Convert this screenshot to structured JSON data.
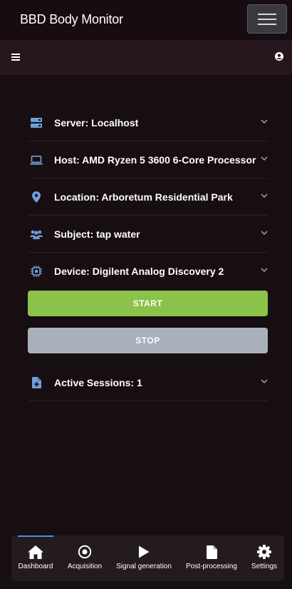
{
  "app": {
    "title": "BBD Body Monitor"
  },
  "colors": {
    "accent_start": "#8bc34a",
    "stop_button": "#a9b0bc",
    "icon_blue": "#6f9fd8",
    "active_indicator": "#4a90e2"
  },
  "list": {
    "items": [
      {
        "icon": "server-icon",
        "label": "Server: Localhost"
      },
      {
        "icon": "laptop-icon",
        "label": "Host: AMD Ryzen 5 3600 6-Core Processor"
      },
      {
        "icon": "location-pin-icon",
        "label": "Location: Arboretum Residential Park"
      },
      {
        "icon": "users-icon",
        "label": "Subject: tap water"
      },
      {
        "icon": "chip-icon",
        "label": "Device: Digilent Analog Discovery 2"
      }
    ]
  },
  "actions": {
    "start_label": "START",
    "stop_label": "STOP"
  },
  "sessions": {
    "icon": "file-plus-icon",
    "label": "Active Sessions: 1"
  },
  "bottom_nav": {
    "items": [
      {
        "icon": "home-icon",
        "label": "Dashboard",
        "active": true
      },
      {
        "icon": "record-icon",
        "label": "Acquisition"
      },
      {
        "icon": "play-icon",
        "label": "Signal generation"
      },
      {
        "icon": "file-icon",
        "label": "Post-processing"
      },
      {
        "icon": "gear-icon",
        "label": "Settings"
      }
    ]
  }
}
